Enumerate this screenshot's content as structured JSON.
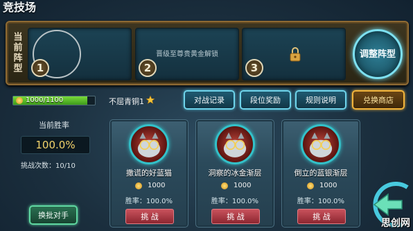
{
  "header": {
    "title": "竞技场"
  },
  "lineup": {
    "label": "当前阵型",
    "slots": [
      {
        "number": "1",
        "text": ""
      },
      {
        "number": "2",
        "text": "晋级至尊贵黄金解锁"
      },
      {
        "number": "3",
        "text": ""
      }
    ],
    "adjust_label": "调整阵型"
  },
  "info": {
    "progress_text": "1000/1100",
    "progress_fraction": 0.909,
    "rank_label": "不屈青铜1",
    "buttons": {
      "history": "对战记录",
      "reward": "段位奖励",
      "rules": "规则说明",
      "shop": "兑换商店"
    }
  },
  "stats": {
    "winrate_label": "当前胜率",
    "winrate_value": "100.0%",
    "challenges": "挑战次数：10/10",
    "swap_label": "换批对手"
  },
  "opponents": [
    {
      "name": "撒谎的好蓝猫",
      "coins": "1000",
      "rate": "胜率：100.0%",
      "action": "挑 战"
    },
    {
      "name": "洞察的冰金渐层",
      "coins": "1000",
      "rate": "胜率：100.0%",
      "action": "挑 战"
    },
    {
      "name": "倒立的蓝银渐层",
      "coins": "1000",
      "rate": "胜率：100.0%",
      "action": "挑 战"
    }
  ],
  "colors": {
    "accent_cyan": "#6ed3ea",
    "gold": "#f2b43b",
    "challenge_red": "#c9525c",
    "winrate": "#f3d36a"
  },
  "icons": {
    "lock": "lock-icon",
    "star": "star-icon",
    "coin": "coin-icon",
    "back": "back-arrow-icon"
  },
  "watermark": "思创网"
}
